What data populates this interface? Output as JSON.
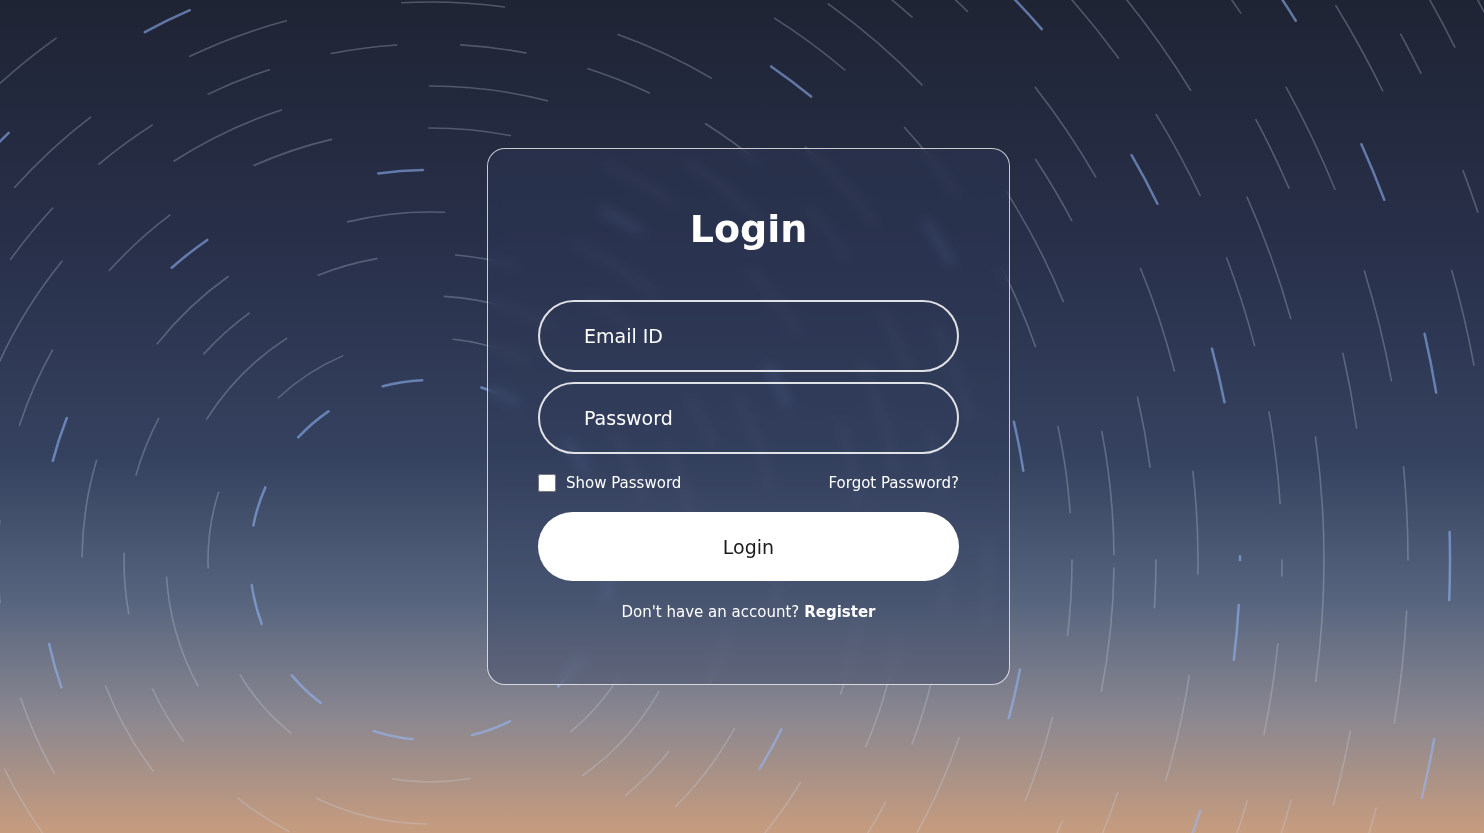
{
  "page": {
    "title": "Login"
  },
  "form": {
    "fields": [
      {
        "name": "email",
        "placeholder": "Email ID",
        "kind": "text"
      },
      {
        "name": "password",
        "placeholder": "Password",
        "kind": "password"
      }
    ],
    "show_password": {
      "label": "Show Password",
      "checked": false
    },
    "forgot_link": "Forgot Password?",
    "submit_button": "Login",
    "footer": {
      "text": "Don't have an account?",
      "link": "Register"
    }
  }
}
